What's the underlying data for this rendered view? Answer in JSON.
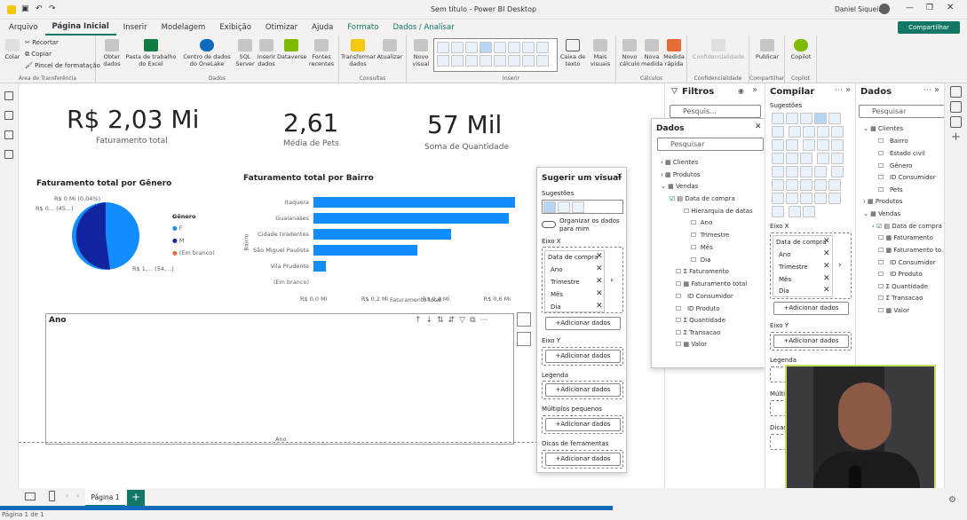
{
  "window": {
    "title": "Sem título - Power BI Desktop",
    "user": "Daniel Siqueira",
    "share": "Compartilhar"
  },
  "menu": [
    "Arquivo",
    "Página Inicial",
    "Inserir",
    "Modelagem",
    "Exibição",
    "Otimizar",
    "Ajuda",
    "Formato",
    "Dados / Analisar"
  ],
  "ribbon": {
    "clipboard": {
      "paste": "Colar",
      "cut": "Recortar",
      "copy": "Copiar",
      "format_painter": "Pincel de formatação",
      "group": "Área de Transferência"
    },
    "data": {
      "get_data": "Obter dados",
      "excel": "Pasta de trabalho do Excel",
      "onelake": "Centro de dados do OneLake",
      "sql": "SQL Server",
      "enter": "Inserir dados",
      "dataverse": "Dataverse",
      "recent": "Fontes recentes",
      "group": "Dados"
    },
    "queries": {
      "transform": "Transformar dados",
      "refresh": "Atualizar",
      "group": "Consultas"
    },
    "insert": {
      "new_visual": "Novo visual",
      "textbox": "Caixa de texto",
      "more": "Mais visuais",
      "group": "Inserir"
    },
    "calc": {
      "new_calc": "Novo cálculo",
      "new_measure": "Nova medida",
      "quick_measure": "Medida rápida",
      "group": "Cálculos"
    },
    "sensitivity": {
      "label": "Confidencialidade",
      "group": "Confidencialidade"
    },
    "share": {
      "publish": "Publicar",
      "group": "Compartilhar"
    },
    "copilot": {
      "label": "Copilot",
      "group": "Copilot"
    }
  },
  "kpis": [
    {
      "value": "R$ 2,03 Mi",
      "label": "Faturamento total"
    },
    {
      "value": "2,61",
      "label": "Média de Pets"
    },
    {
      "value": "57 Mil",
      "label": "Soma de Quantidade"
    }
  ],
  "pie": {
    "title": "Faturamento total por Gênero",
    "legend_title": "Gênero",
    "legend": [
      {
        "name": "F",
        "color": "#118dff"
      },
      {
        "name": "M",
        "color": "#12239e"
      },
      {
        "name": "(Em branco)",
        "color": "#e66c37"
      }
    ],
    "labels": [
      "R$ 0 Mi (0,04%)",
      "R$ 0... (45...)",
      "R$ 1,... (54,...)"
    ]
  },
  "chart_data": {
    "type": "bar",
    "title": "Faturamento total por Bairro",
    "categories": [
      "Itaquera",
      "Guaianases",
      "Cidade tiradentes",
      "São Miguel Paulista",
      "Vila Prudente",
      "(Em branco)"
    ],
    "values": [
      0.66,
      0.64,
      0.45,
      0.34,
      0.04,
      0
    ],
    "xlabel": "Faturamento total",
    "ylabel": "Bairro",
    "xticks": [
      "R$ 0,0 Mi",
      "R$ 0,2 Mi",
      "R$ 0,4 Mi",
      "R$ 0,6 Mi"
    ],
    "xlim": [
      0,
      0.7
    ],
    "color": "#118dff"
  },
  "empty_visual": {
    "title": "Ano",
    "axis": "Ano"
  },
  "suggest": {
    "title": "Sugerir um visual",
    "suggestions": "Sugestões",
    "toggle": "Organizar os dados para mim",
    "x_axis": "Eixo X",
    "x_fields": [
      "Data de compra",
      "Ano",
      "Trimestre",
      "Mês",
      "Dia"
    ],
    "add": "+Adicionar dados",
    "y_axis": "Eixo Y",
    "legend": "Legenda",
    "multiples": "Múltiplos pequenos",
    "tooltips": "Dicas de ferramentas"
  },
  "filters": {
    "title": "Filtros",
    "search": "Pesquis..."
  },
  "data_popup": {
    "title": "Dados",
    "search": "Pesquisar",
    "items": [
      "Clientes",
      "Produtos",
      "Vendas",
      "Data de compra",
      "Hierarquia de datas",
      "Ano",
      "Trimestre",
      "Mês",
      "Dia",
      "Faturamento",
      "Faturamento total",
      "ID Consumidor",
      "ID Produto",
      "Quantidade",
      "Transacao",
      "Valor"
    ]
  },
  "compile": {
    "title": "Compilar",
    "suggestions": "Sugestões",
    "x_axis": "Eixo X",
    "x_fields": [
      "Data de compra",
      "Ano",
      "Trimestre",
      "Mês",
      "Dia"
    ],
    "add": "+Adicionar dados",
    "y_axis": "Eixo Y",
    "legend": "Legenda",
    "multiples": "Múltipl",
    "tips": "Dicas"
  },
  "data_pane": {
    "title": "Dados",
    "search": "Pesquisar",
    "clientes": "Clientes",
    "clientes_fields": [
      "Bairro",
      "Estado civil",
      "Gênero",
      "ID Consumidor",
      "Pets"
    ],
    "produtos": "Produtos",
    "vendas": "Vendas",
    "vendas_fields": [
      "Data de compra",
      "Faturamento",
      "Faturamento to...",
      "ID Consumidor",
      "ID Produto",
      "Quantidade",
      "Transacao",
      "Valor"
    ]
  },
  "status": {
    "page_tab": "Página 1",
    "page_info": "Página 1 de 1"
  }
}
